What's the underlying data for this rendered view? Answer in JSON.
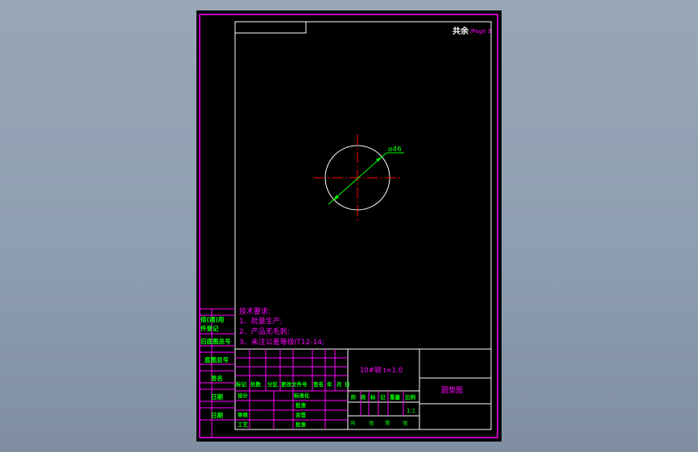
{
  "colors": {
    "background": "#000000",
    "frame": "#ff00ff",
    "label": "#00ff00",
    "white": "#ffffff",
    "centerline": "#ff0000",
    "dimension": "#00ff00"
  },
  "header": {
    "sheet_label": "共余",
    "sheet_suffix": "/Page 3"
  },
  "drawing": {
    "dimension_text": "⌀46"
  },
  "technical_requirements": {
    "title": "技术要求:",
    "items": [
      "1、批量生产;",
      "2、产品无毛刺;",
      "3、未注公差等级IT12-14;"
    ]
  },
  "left_column": {
    "labels": [
      "借(通)用",
      "件登记",
      "旧底图总号",
      "底图总号",
      "签名",
      "日期",
      "日期"
    ]
  },
  "title_block": {
    "material": "10#钢  t=1.0",
    "part_name": "圆垫图",
    "revision_headers": [
      "标记",
      "处数",
      "分区",
      "更改文件号",
      "签名",
      "年",
      "月",
      "日"
    ],
    "role_labels": [
      "设计",
      "审核",
      "工艺"
    ],
    "right_labels": [
      "标准化",
      "批准",
      "会签",
      "批准"
    ],
    "stage_headers": [
      "阶",
      "段",
      "标",
      "记",
      "重量",
      "比例"
    ],
    "scale": "1:1",
    "sheet_row": [
      "共",
      "张",
      "第",
      "张"
    ]
  }
}
